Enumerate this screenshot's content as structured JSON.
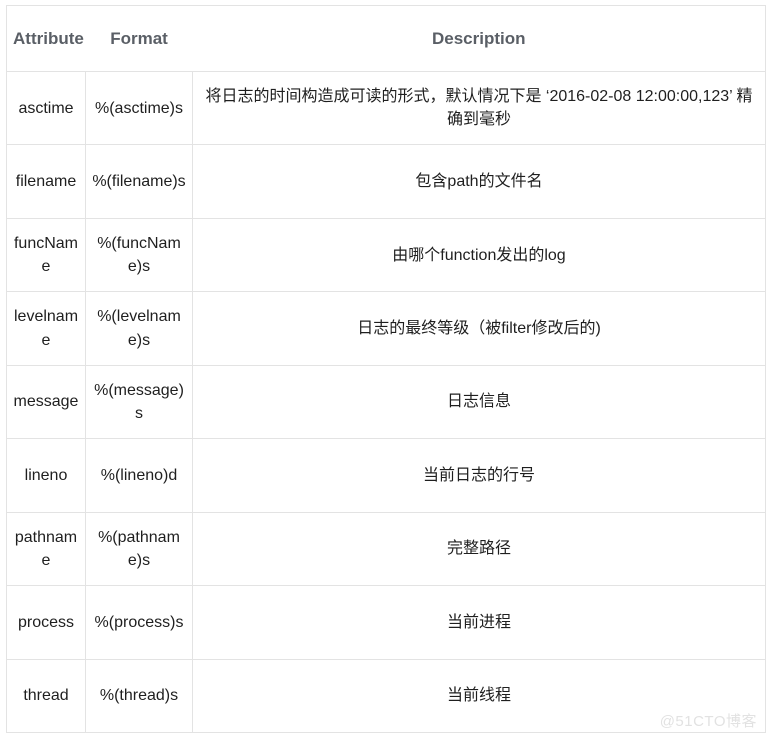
{
  "table": {
    "headers": {
      "attribute": "Attribute",
      "format": "Format",
      "description": "Description"
    },
    "rows": [
      {
        "attribute": "asctime",
        "format": "%(asctime)s",
        "description": "将日志的时间构造成可读的形式，默认情况下是 ‘2016-02-08 12:00:00,123’ 精确到毫秒"
      },
      {
        "attribute": "filename",
        "format": "%(filename)s",
        "description": "包含path的文件名"
      },
      {
        "attribute": "funcName",
        "format": "%(funcName)s",
        "description": "由哪个function发出的log"
      },
      {
        "attribute": "levelname",
        "format": "%(levelname)s",
        "description": "日志的最终等级（被filter修改后的)"
      },
      {
        "attribute": "message",
        "format": "%(message)s",
        "description": "日志信息"
      },
      {
        "attribute": "lineno",
        "format": "%(lineno)d",
        "description": "当前日志的行号"
      },
      {
        "attribute": "pathname",
        "format": "%(pathname)s",
        "description": "完整路径"
      },
      {
        "attribute": "process",
        "format": "%(process)s",
        "description": "当前进程"
      },
      {
        "attribute": "thread",
        "format": "%(thread)s",
        "description": "当前线程"
      }
    ]
  },
  "watermark": {
    "text": "@51CTO博客"
  },
  "colors": {
    "header_text": "#5a5f66",
    "body_text": "#1f1f1f",
    "border": "#e3e3e3",
    "watermark": "#e2e2e2",
    "background": "#ffffff"
  }
}
